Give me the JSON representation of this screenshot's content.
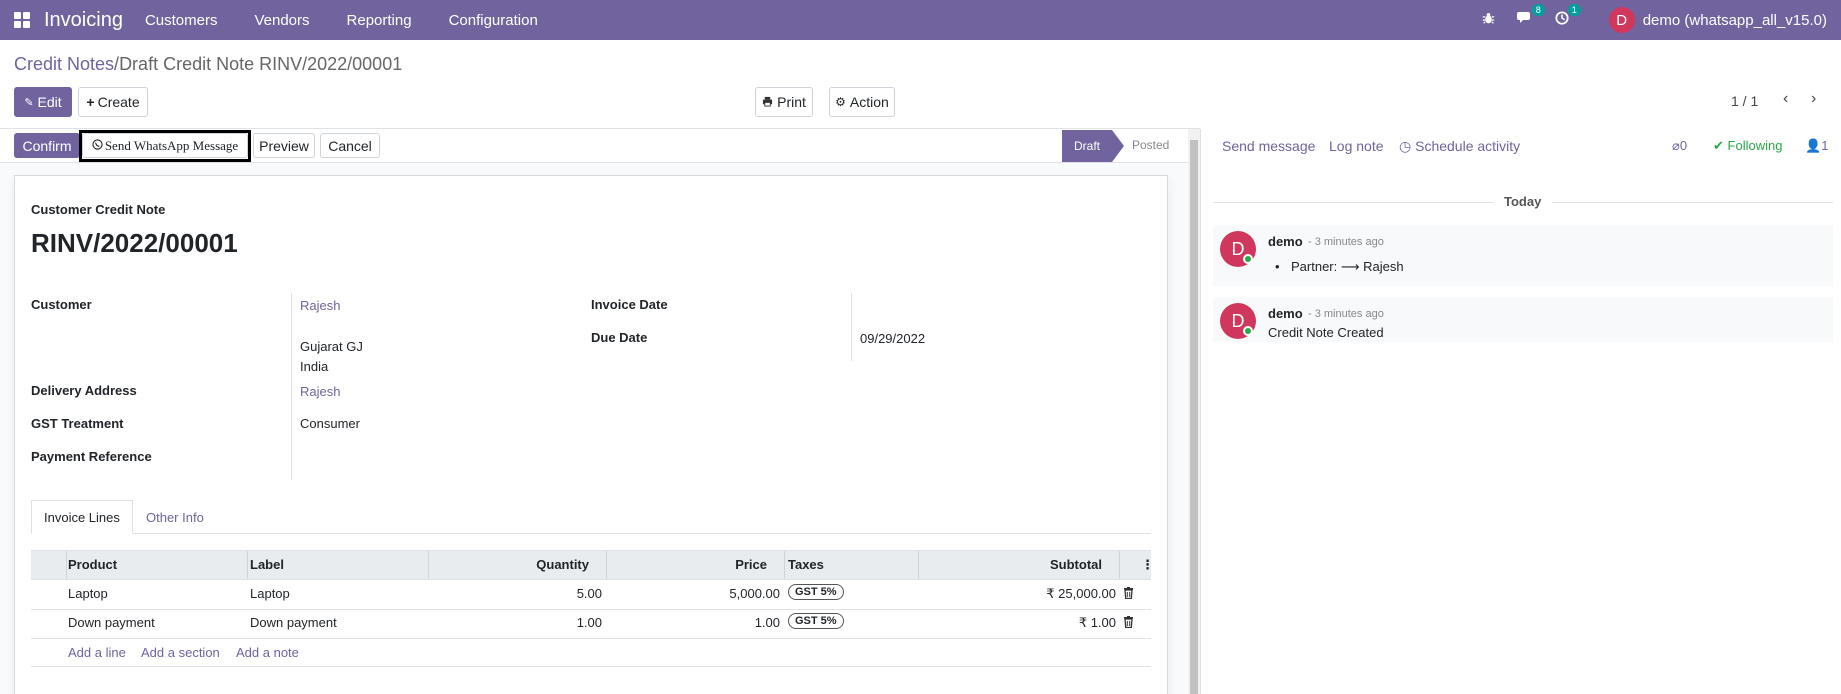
{
  "topnav": {
    "app_name": "Invoicing",
    "menu": [
      "Customers",
      "Vendors",
      "Reporting",
      "Configuration"
    ],
    "messages_badge": "8",
    "activity_badge": "1",
    "avatar_letter": "D",
    "user": "demo (whatsapp_all_v15.0)"
  },
  "breadcrumb": {
    "parent": "Credit Notes",
    "separator": "/",
    "current": "Draft Credit Note RINV/2022/00001"
  },
  "controls": {
    "edit": "Edit",
    "create": "Create",
    "print": "Print",
    "action": "Action",
    "pager": "1 / 1"
  },
  "statusbar": {
    "confirm": "Confirm",
    "send_whatsapp": "Send WhatsApp Message",
    "preview": "Preview",
    "cancel": "Cancel",
    "stages": [
      "Draft",
      "Posted"
    ]
  },
  "form": {
    "doc_type": "Customer Credit Note",
    "number": "RINV/2022/00001",
    "customer_label": "Customer",
    "customer_name": "Rajesh",
    "customer_addr1": "Gujarat GJ",
    "customer_addr2": "India",
    "delivery_label": "Delivery Address",
    "delivery_value": "Rajesh",
    "gst_label": "GST Treatment",
    "gst_value": "Consumer",
    "payref_label": "Payment Reference",
    "invoice_date_label": "Invoice Date",
    "invoice_date_value": "",
    "due_date_label": "Due Date",
    "due_date_value": "09/29/2022"
  },
  "tabs": [
    "Invoice Lines",
    "Other Info"
  ],
  "table": {
    "columns": [
      "Product",
      "Label",
      "Quantity",
      "Price",
      "Taxes",
      "Subtotal"
    ],
    "rows": [
      {
        "product": "Laptop",
        "label": "Laptop",
        "quantity": "5.00",
        "price": "5,000.00",
        "tax": "GST 5%",
        "subtotal": "₹ 25,000.00"
      },
      {
        "product": "Down payment",
        "label": "Down payment",
        "quantity": "1.00",
        "price": "1.00",
        "tax": "GST 5%",
        "subtotal": "₹ 1.00"
      }
    ],
    "add_line": "Add a line",
    "add_section": "Add a section",
    "add_note": "Add a note"
  },
  "chatter": {
    "send_message": "Send message",
    "log_note": "Log note",
    "schedule_activity": "Schedule activity",
    "attachments": "0",
    "following": "Following",
    "followers": "1",
    "date_separator": "Today",
    "messages": [
      {
        "avatar": "D",
        "author": "demo",
        "time": "- 3 minutes ago",
        "body_prefix": "Partner:",
        "body_arrow": "⟶",
        "body_value": "Rajesh"
      },
      {
        "avatar": "D",
        "author": "demo",
        "time": "- 3 minutes ago",
        "body": "Credit Note Created"
      }
    ]
  },
  "colors": {
    "brand": "#71639e",
    "avatar": "#d0375c",
    "following": "#28a745"
  }
}
